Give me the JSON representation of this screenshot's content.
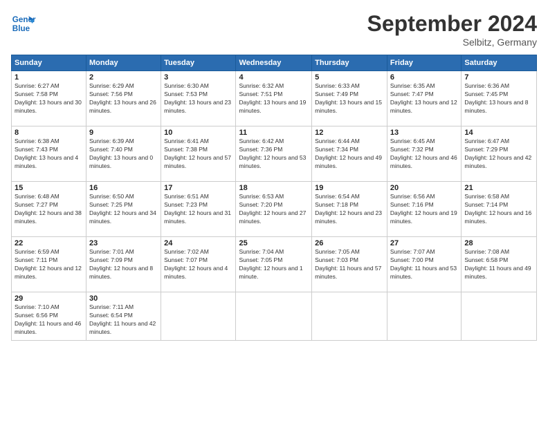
{
  "header": {
    "logo_line1": "General",
    "logo_line2": "Blue",
    "month": "September 2024",
    "location": "Selbitz, Germany"
  },
  "days_of_week": [
    "Sunday",
    "Monday",
    "Tuesday",
    "Wednesday",
    "Thursday",
    "Friday",
    "Saturday"
  ],
  "weeks": [
    [
      {
        "day": "1",
        "sunrise": "6:27 AM",
        "sunset": "7:58 PM",
        "daylight": "13 hours and 30 minutes."
      },
      {
        "day": "2",
        "sunrise": "6:29 AM",
        "sunset": "7:56 PM",
        "daylight": "13 hours and 26 minutes."
      },
      {
        "day": "3",
        "sunrise": "6:30 AM",
        "sunset": "7:53 PM",
        "daylight": "13 hours and 23 minutes."
      },
      {
        "day": "4",
        "sunrise": "6:32 AM",
        "sunset": "7:51 PM",
        "daylight": "13 hours and 19 minutes."
      },
      {
        "day": "5",
        "sunrise": "6:33 AM",
        "sunset": "7:49 PM",
        "daylight": "13 hours and 15 minutes."
      },
      {
        "day": "6",
        "sunrise": "6:35 AM",
        "sunset": "7:47 PM",
        "daylight": "13 hours and 12 minutes."
      },
      {
        "day": "7",
        "sunrise": "6:36 AM",
        "sunset": "7:45 PM",
        "daylight": "13 hours and 8 minutes."
      }
    ],
    [
      {
        "day": "8",
        "sunrise": "6:38 AM",
        "sunset": "7:43 PM",
        "daylight": "13 hours and 4 minutes."
      },
      {
        "day": "9",
        "sunrise": "6:39 AM",
        "sunset": "7:40 PM",
        "daylight": "13 hours and 0 minutes."
      },
      {
        "day": "10",
        "sunrise": "6:41 AM",
        "sunset": "7:38 PM",
        "daylight": "12 hours and 57 minutes."
      },
      {
        "day": "11",
        "sunrise": "6:42 AM",
        "sunset": "7:36 PM",
        "daylight": "12 hours and 53 minutes."
      },
      {
        "day": "12",
        "sunrise": "6:44 AM",
        "sunset": "7:34 PM",
        "daylight": "12 hours and 49 minutes."
      },
      {
        "day": "13",
        "sunrise": "6:45 AM",
        "sunset": "7:32 PM",
        "daylight": "12 hours and 46 minutes."
      },
      {
        "day": "14",
        "sunrise": "6:47 AM",
        "sunset": "7:29 PM",
        "daylight": "12 hours and 42 minutes."
      }
    ],
    [
      {
        "day": "15",
        "sunrise": "6:48 AM",
        "sunset": "7:27 PM",
        "daylight": "12 hours and 38 minutes."
      },
      {
        "day": "16",
        "sunrise": "6:50 AM",
        "sunset": "7:25 PM",
        "daylight": "12 hours and 34 minutes."
      },
      {
        "day": "17",
        "sunrise": "6:51 AM",
        "sunset": "7:23 PM",
        "daylight": "12 hours and 31 minutes."
      },
      {
        "day": "18",
        "sunrise": "6:53 AM",
        "sunset": "7:20 PM",
        "daylight": "12 hours and 27 minutes."
      },
      {
        "day": "19",
        "sunrise": "6:54 AM",
        "sunset": "7:18 PM",
        "daylight": "12 hours and 23 minutes."
      },
      {
        "day": "20",
        "sunrise": "6:56 AM",
        "sunset": "7:16 PM",
        "daylight": "12 hours and 19 minutes."
      },
      {
        "day": "21",
        "sunrise": "6:58 AM",
        "sunset": "7:14 PM",
        "daylight": "12 hours and 16 minutes."
      }
    ],
    [
      {
        "day": "22",
        "sunrise": "6:59 AM",
        "sunset": "7:11 PM",
        "daylight": "12 hours and 12 minutes."
      },
      {
        "day": "23",
        "sunrise": "7:01 AM",
        "sunset": "7:09 PM",
        "daylight": "12 hours and 8 minutes."
      },
      {
        "day": "24",
        "sunrise": "7:02 AM",
        "sunset": "7:07 PM",
        "daylight": "12 hours and 4 minutes."
      },
      {
        "day": "25",
        "sunrise": "7:04 AM",
        "sunset": "7:05 PM",
        "daylight": "12 hours and 1 minute."
      },
      {
        "day": "26",
        "sunrise": "7:05 AM",
        "sunset": "7:03 PM",
        "daylight": "11 hours and 57 minutes."
      },
      {
        "day": "27",
        "sunrise": "7:07 AM",
        "sunset": "7:00 PM",
        "daylight": "11 hours and 53 minutes."
      },
      {
        "day": "28",
        "sunrise": "7:08 AM",
        "sunset": "6:58 PM",
        "daylight": "11 hours and 49 minutes."
      }
    ],
    [
      {
        "day": "29",
        "sunrise": "7:10 AM",
        "sunset": "6:56 PM",
        "daylight": "11 hours and 46 minutes."
      },
      {
        "day": "30",
        "sunrise": "7:11 AM",
        "sunset": "6:54 PM",
        "daylight": "11 hours and 42 minutes."
      },
      null,
      null,
      null,
      null,
      null
    ]
  ]
}
